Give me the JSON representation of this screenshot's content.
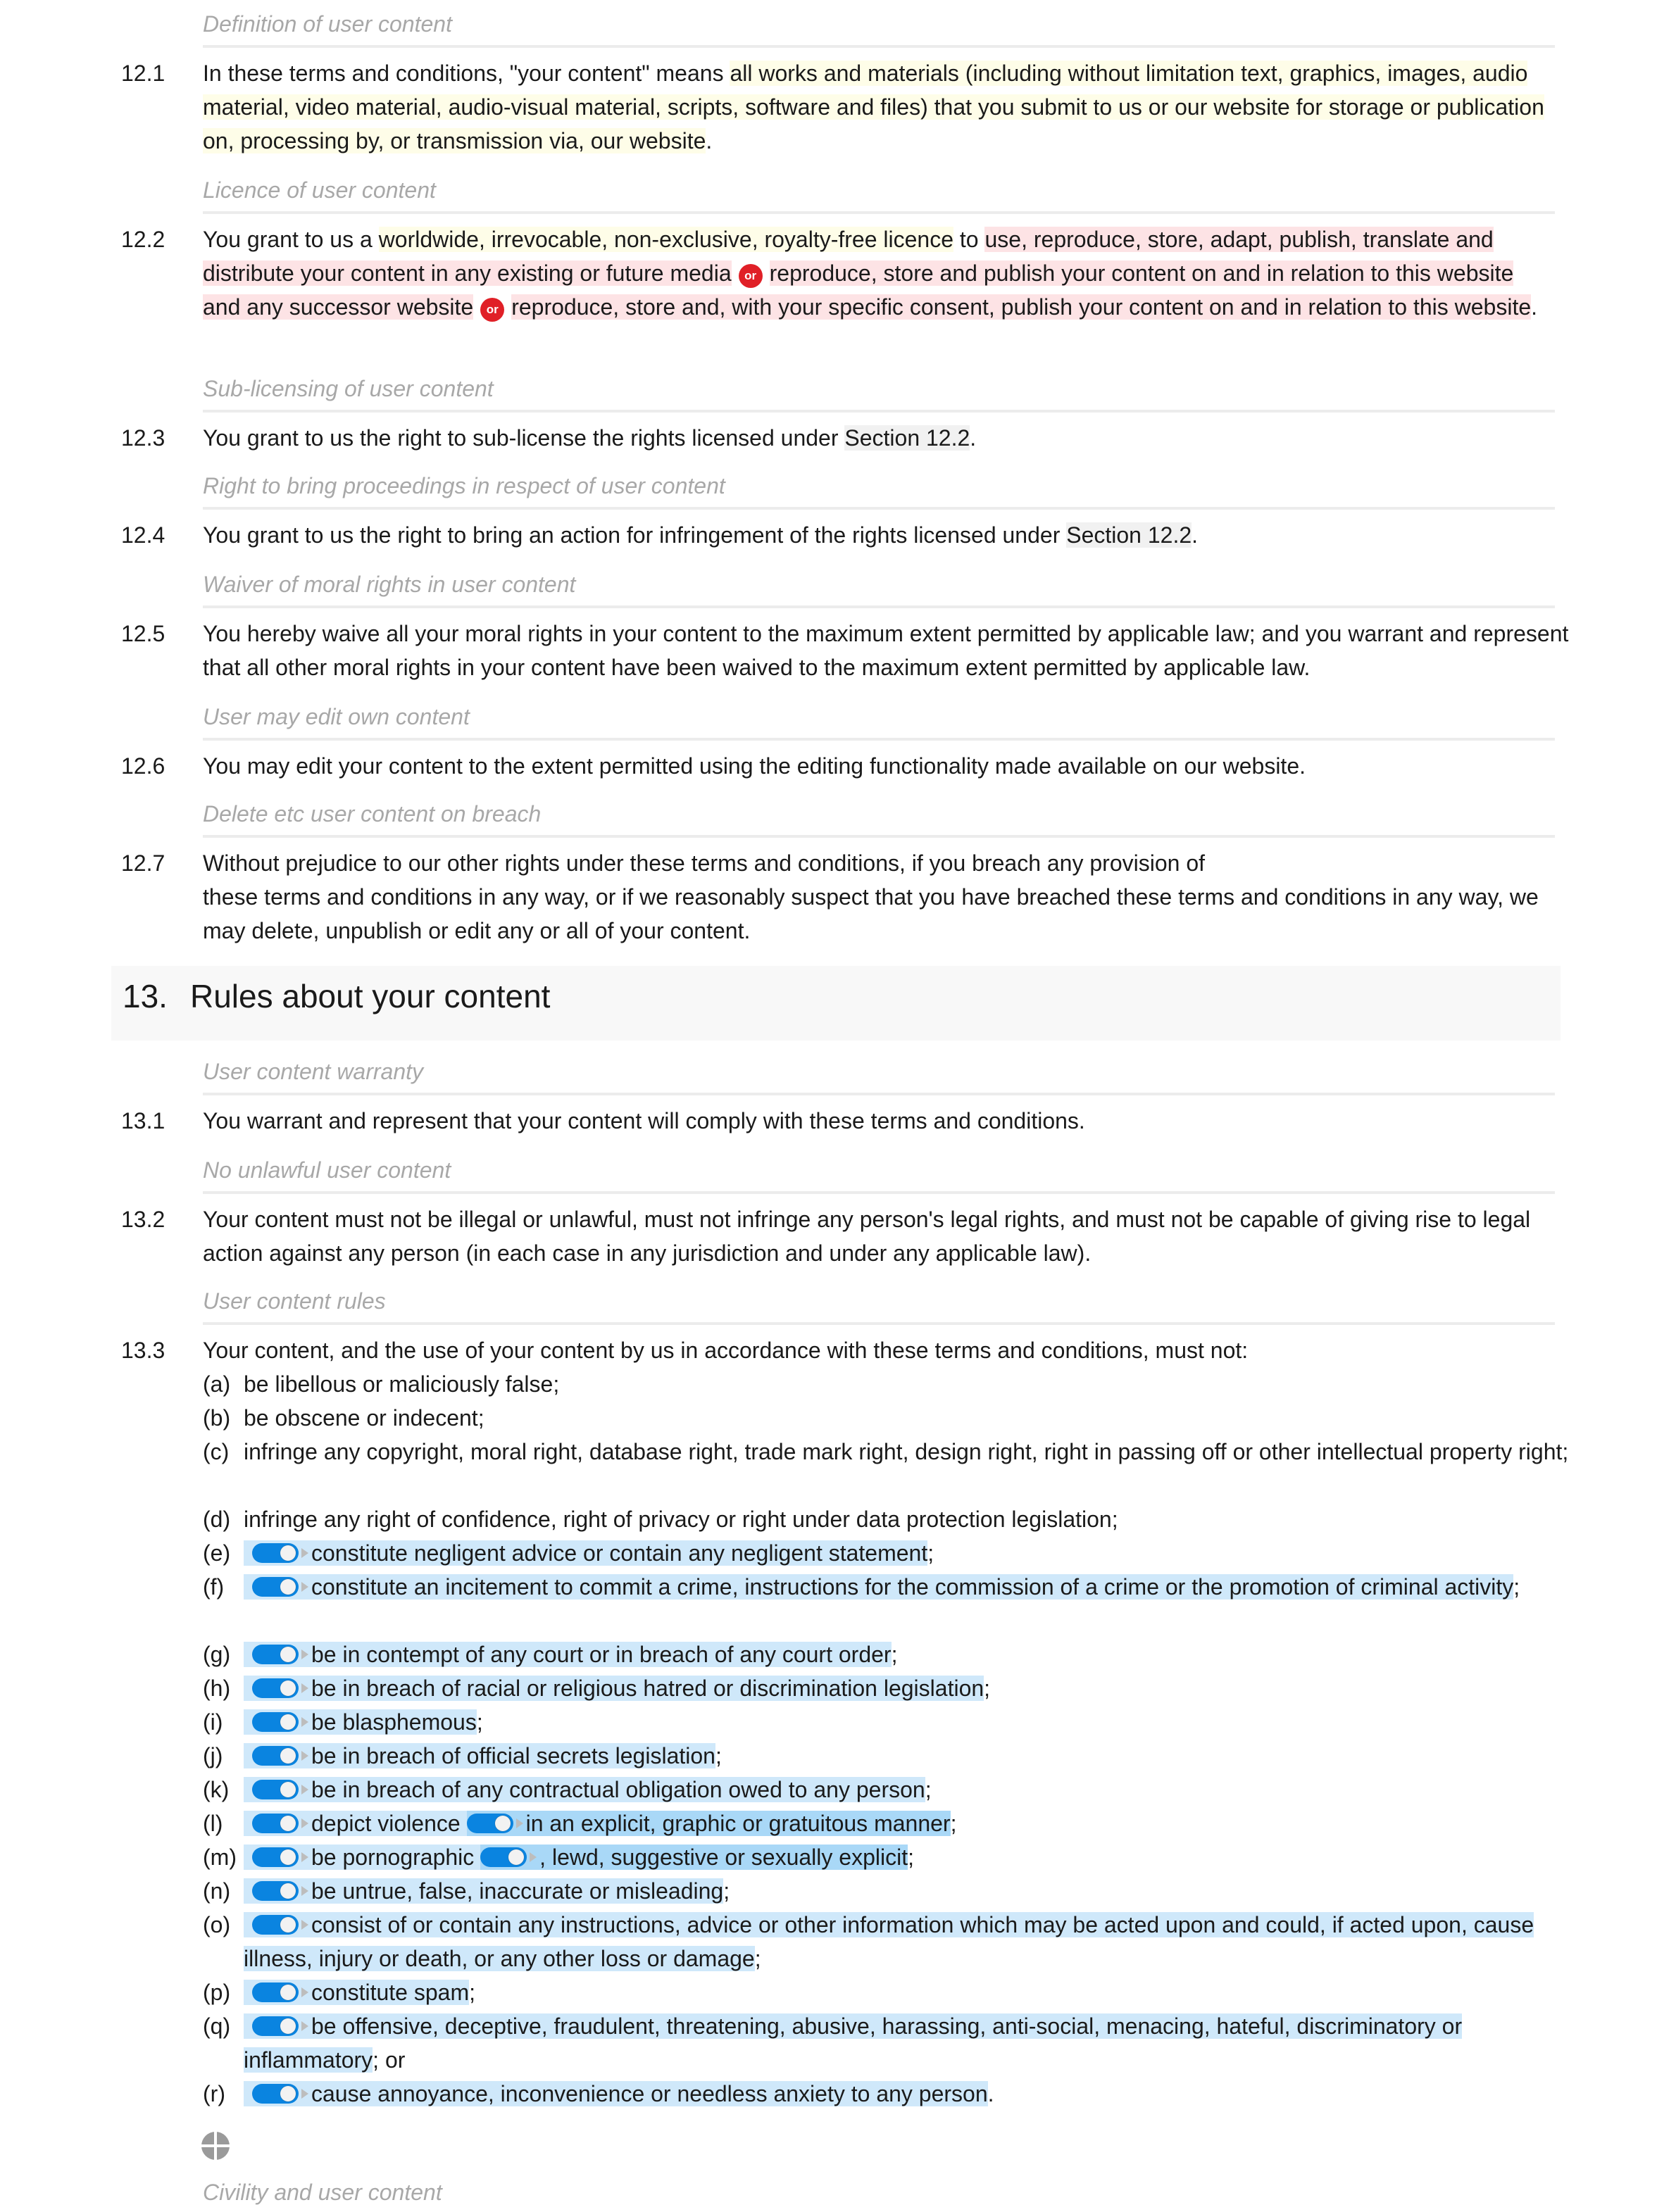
{
  "section12": {
    "clauses": [
      {
        "subheading": "Definition of user content",
        "number": "12.1",
        "parts": [
          "In these terms and conditions, \"your content\" means ",
          "all works and materials (including without limitation text, graphics, images, audio material, video material, audio-visual material, scripts, software and files) that you submit to us or our website for storage or publication on, processing by, or transmission via, our website",
          "."
        ]
      },
      {
        "subheading": "Licence of user content",
        "number": "12.2",
        "parts": [
          "You grant to us a ",
          "worldwide, irrevocable, non-exclusive, royalty-free licence",
          " to ",
          "use, reproduce, store, adapt, publish, translate and distribute your content in any existing or future media",
          "or",
          "reproduce, store and publish your content on and in relation to this website and any successor website",
          "or",
          "reproduce, store and, with your specific consent, publish your content on and in relation to this website",
          "."
        ]
      },
      {
        "subheading": "Sub-licensing of user content",
        "number": "12.3",
        "parts": [
          "You grant to us the right to sub-license the rights licensed under ",
          "Section 12.2",
          "."
        ]
      },
      {
        "subheading": "Right to bring proceedings in respect of user content",
        "number": "12.4",
        "parts": [
          "You grant to us the right to bring an action for infringement of the rights licensed under ",
          "Section 12.2",
          "."
        ]
      },
      {
        "subheading": "Waiver of moral rights in user content",
        "number": "12.5",
        "text": "You hereby waive all your moral rights in your content to the maximum extent permitted by applicable law; and you warrant and represent that all other moral rights in your content have been waived to the maximum extent permitted by applicable law."
      },
      {
        "subheading": "User may edit own content",
        "number": "12.6",
        "text": "You may edit your content to the extent permitted using the editing functionality made available on our website."
      },
      {
        "subheading": "Delete etc user content on breach",
        "number": "12.7",
        "line1": "Without prejudice to our other rights under these terms and conditions, if you breach any provision of",
        "line2": "these terms and conditions in any way, or if we reasonably suspect that you have breached these terms and conditions in any way, we may delete, unpublish or edit any or all of your content."
      }
    ]
  },
  "section13": {
    "number": "13.",
    "title": "Rules about your content",
    "clauses": [
      {
        "subheading": "User content warranty",
        "number": "13.1",
        "text": "You warrant and represent that your content will comply with these terms and conditions."
      },
      {
        "subheading": "No unlawful user content",
        "number": "13.2",
        "text": "Your content must not be illegal or unlawful, must not infringe any person's legal rights, and must not be capable of giving rise to legal action against any person (in each case in any jurisdiction and under any applicable law)."
      },
      {
        "subheading": "User content rules",
        "number": "13.3",
        "text": "Your content, and the use of your content by us in accordance with these terms and conditions, must not:"
      }
    ],
    "list": [
      {
        "label": "(a)",
        "text": "be libellous or maliciously false;"
      },
      {
        "label": "(b)",
        "text": "be obscene or indecent;"
      },
      {
        "label": "(c)",
        "text": "infringe any copyright, moral right, database right, trade mark right, design right, right in passing off or other intellectual property right;"
      },
      {
        "label": "(d)",
        "text": "infringe any right of confidence, right of privacy or right under data protection legislation;"
      },
      {
        "label": "(e)",
        "toggle_on": true,
        "text": "constitute negligent advice or contain any negligent statement",
        "after": ";"
      },
      {
        "label": "(f)",
        "toggle_on": true,
        "text": "constitute an incitement to commit a crime, instructions for the commission of a crime or the promotion of criminal activity",
        "after": ";"
      },
      {
        "label": "(g)",
        "toggle_on": true,
        "text": "be in contempt of any court or in breach of any court order",
        "after": ";"
      },
      {
        "label": "(h)",
        "toggle_on": true,
        "text": "be in breach of racial or religious hatred or discrimination legislation",
        "after": ";"
      },
      {
        "label": "(i)",
        "toggle_on": true,
        "text": "be blasphemous",
        "after": ";"
      },
      {
        "label": "(j)",
        "toggle_on": true,
        "text": "be in breach of official secrets legislation",
        "after": ";"
      },
      {
        "label": "(k)",
        "toggle_on": true,
        "text": "be in breach of any contractual obligation owed to any person",
        "after": ";"
      },
      {
        "label": "(l)",
        "toggle_on": true,
        "text": "depict violence",
        "nested_toggle_on": true,
        "nested_text": "in an explicit, graphic or gratuitous manner",
        "after": ";"
      },
      {
        "label": "(m)",
        "toggle_on": true,
        "text": "be pornographic",
        "nested_toggle_on": true,
        "nested_text": ", lewd, suggestive or sexually explicit",
        "after": ";"
      },
      {
        "label": "(n)",
        "toggle_on": true,
        "text": "be untrue, false, inaccurate or misleading",
        "after": ";"
      },
      {
        "label": "(o)",
        "toggle_on": true,
        "text": "consist of or contain any instructions, advice or other information which may be acted upon and could, if acted upon, cause illness, injury or death, or any other loss or damage",
        "after": ";"
      },
      {
        "label": "(p)",
        "toggle_on": true,
        "text": "constitute spam",
        "after": ";"
      },
      {
        "label": "(q)",
        "toggle_on": true,
        "text": "be offensive, deceptive, fraudulent, threatening, abusive, harassing, anti-social, menacing, hateful, discriminatory or inflammatory",
        "after": "; or"
      },
      {
        "label": "(r)",
        "toggle_on": true,
        "text": "cause annoyance, inconvenience or needless anxiety to any person",
        "after": "."
      }
    ],
    "next_subheading": "Civility and user content"
  },
  "icons": {
    "add": "add-circle-icon",
    "toggle": "toggle-on-icon",
    "or": "or-badge"
  },
  "colors": {
    "highlight_yellow": "#fefde8",
    "highlight_red": "#fde3e5",
    "highlight_blue": "#cfe8fa",
    "highlight_blue_nested": "#a9d8f7",
    "toggle_blue": "#0a84e0",
    "or_red": "#e02027"
  }
}
